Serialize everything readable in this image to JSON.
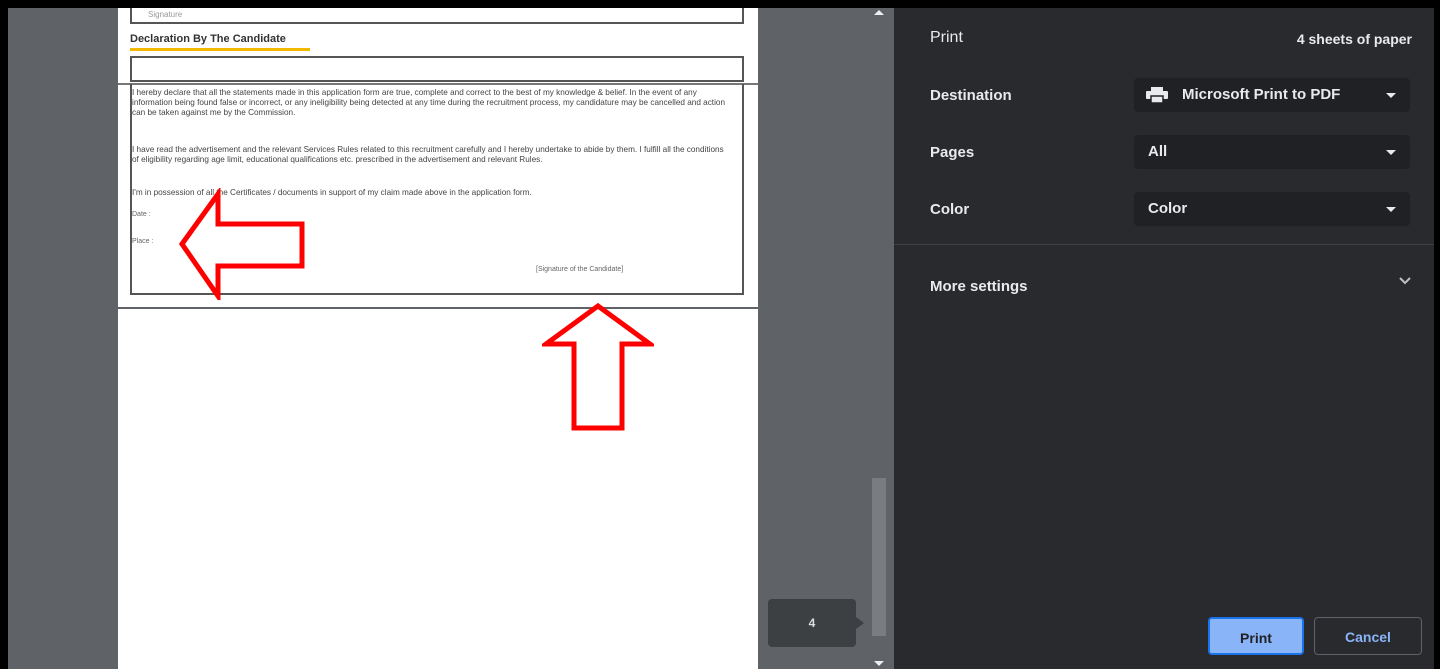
{
  "preview": {
    "signature_label": "Signature",
    "declaration_title": "Declaration By The Candidate",
    "paragraph1": "I hereby declare that all the statements made in this application form are true, complete and correct to the best of my knowledge & belief. In the event of any information being found false or incorrect, or any ineligibility being detected at any time during the recruitment process, my candidature may be cancelled and action can be taken against me by the Commission.",
    "paragraph2": "I have read the advertisement and the relevant Services Rules related to this recruitment carefully and I hereby undertake to abide by them. I fulfill all the conditions of eligibility regarding age limit, educational qualifications etc. prescribed in the advertisement and relevant Rules.",
    "paragraph3": "I'm in possession of all the Certificates / documents in support of my claim made above in the application form.",
    "date_label": "Date :",
    "place_label": "Place :",
    "candidate_signature": "[Signature of the Candidate]",
    "page_indicator": "4"
  },
  "panel": {
    "title": "Print",
    "sheets": "4 sheets of paper",
    "destination_label": "Destination",
    "destination_value": "Microsoft Print to PDF",
    "pages_label": "Pages",
    "pages_value": "All",
    "color_label": "Color",
    "color_value": "Color",
    "more_settings": "More settings",
    "print_button": "Print",
    "cancel_button": "Cancel"
  },
  "colors": {
    "panel_bg": "#292a2d",
    "select_bg": "#202124",
    "accent": "#8ab4f8",
    "annotation_red": "#ff0000"
  },
  "icons": [
    "printer-icon",
    "chevron-down-icon",
    "arrow-left-annotation",
    "arrow-up-annotation"
  ]
}
